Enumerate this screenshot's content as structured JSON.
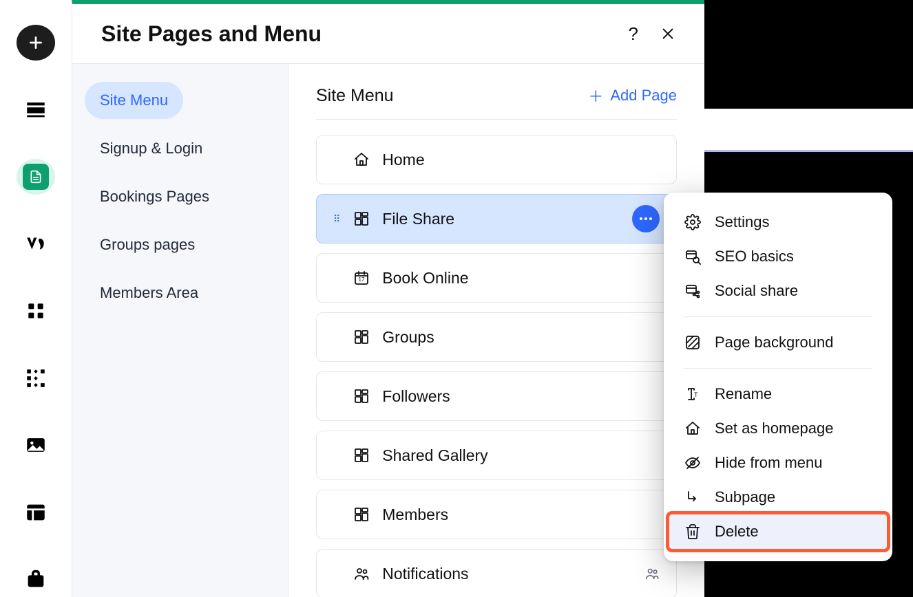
{
  "panel": {
    "title": "Site Pages and Menu"
  },
  "sidebar": {
    "items": [
      {
        "label": "Site Menu",
        "active": true
      },
      {
        "label": "Signup & Login",
        "active": false
      },
      {
        "label": "Bookings Pages",
        "active": false
      },
      {
        "label": "Groups pages",
        "active": false
      },
      {
        "label": "Members Area",
        "active": false
      }
    ]
  },
  "main": {
    "title": "Site Menu",
    "add_label": "Add Page",
    "pages": [
      {
        "label": "Home",
        "icon": "home"
      },
      {
        "label": "File Share",
        "icon": "dashboard",
        "selected": true
      },
      {
        "label": "Book Online",
        "icon": "calendar"
      },
      {
        "label": "Groups",
        "icon": "dashboard"
      },
      {
        "label": "Followers",
        "icon": "dashboard"
      },
      {
        "label": "Shared Gallery",
        "icon": "dashboard"
      },
      {
        "label": "Members",
        "icon": "dashboard"
      },
      {
        "label": "Notifications",
        "icon": "people",
        "right_icon": "people"
      }
    ]
  },
  "context_menu": {
    "groups": [
      [
        {
          "label": "Settings",
          "icon": "gear"
        },
        {
          "label": "SEO basics",
          "icon": "seo"
        },
        {
          "label": "Social share",
          "icon": "social"
        }
      ],
      [
        {
          "label": "Page background",
          "icon": "background"
        }
      ],
      [
        {
          "label": "Rename",
          "icon": "rename"
        },
        {
          "label": "Set as homepage",
          "icon": "home"
        },
        {
          "label": "Hide from menu",
          "icon": "hide"
        },
        {
          "label": "Subpage",
          "icon": "subpage"
        },
        {
          "label": "Delete",
          "icon": "trash",
          "highlight": true
        }
      ]
    ]
  },
  "icons": {
    "help": "?"
  }
}
